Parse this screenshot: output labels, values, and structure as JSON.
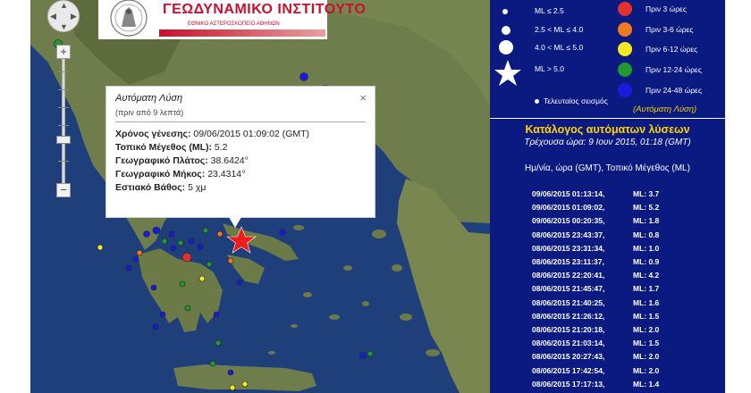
{
  "logo": {
    "title": "ΓΕΩΔΥΝΑΜΙΚΟ ΙΝΣΤΙΤΟΥΤΟ",
    "subtitle": "ΕΘΝΙΚΟ ΑΣΤΕΡΟΣΚΟΠΕΙΟ ΑΘΗΝΩΝ"
  },
  "map_controls": {
    "zoom_in": "+",
    "zoom_out": "−"
  },
  "popup": {
    "title": "Αυτόματη Λύση",
    "subtitle": "(πριν από 9 λεπτά)",
    "close": "×",
    "rows": [
      {
        "label": "Χρόνος γένεσης:",
        "value": "09/06/2015  01:09:02 (GMT)"
      },
      {
        "label": "Τοπικό Μέγεθος (ML):",
        "value": "5.2"
      },
      {
        "label": "Γεωγραφικό Πλάτος:",
        "value": "38.6424°"
      },
      {
        "label": "Γεωγραφικό Μήκος:",
        "value": "23.4314°"
      },
      {
        "label": "Εστιακό Βάθος:",
        "value": "5 χμ"
      }
    ]
  },
  "legend": {
    "magnitudes": [
      {
        "label": "ML ≤ 2.5"
      },
      {
        "label": "2.5 < ML ≤ 4.0"
      },
      {
        "label": "4.0 < ML ≤ 5.0"
      },
      {
        "label": "ML > 5.0"
      },
      {
        "label": "Τελευταίος σεισμός"
      }
    ],
    "ages": [
      {
        "label": "Πριν 3 ώρες",
        "color": "#e53030"
      },
      {
        "label": "Πριν 3-6 ώρες",
        "color": "#f07a20"
      },
      {
        "label": "Πριν 6-12 ώρες",
        "color": "#f5ea20"
      },
      {
        "label": "Πριν 12-24 ώρες",
        "color": "#1f9a2c"
      },
      {
        "label": "Πριν 24-48 ώρες",
        "color": "#1a1adc"
      }
    ],
    "auto_note": "(Αυτόματη Λύση)"
  },
  "catalog": {
    "title": "Κατάλογος αυτόματων λύσεων",
    "current_time": "Τρέχουσα ώρα: 9 Ιουν 2015, 01:18 (GMT)",
    "header": "Ημ/νία, ώρα (GMT), Τοπικό Μέγεθος (ML)",
    "rows": [
      {
        "datetime": "09/06/2015  01:13:14,",
        "ml": "ML: 3.7"
      },
      {
        "datetime": "09/06/2015  01:09:02,",
        "ml": "ML: 5.2"
      },
      {
        "datetime": "09/06/2015  00:20:35,",
        "ml": "ML: 1.8"
      },
      {
        "datetime": "08/06/2015  23:43:37,",
        "ml": "ML: 0.8"
      },
      {
        "datetime": "08/06/2015  23:31:34,",
        "ml": "ML: 1.0"
      },
      {
        "datetime": "08/06/2015  23:11:37,",
        "ml": "ML: 0.9"
      },
      {
        "datetime": "08/06/2015  22:20:41,",
        "ml": "ML: 4.2"
      },
      {
        "datetime": "08/06/2015  21:45:47,",
        "ml": "ML: 1.7"
      },
      {
        "datetime": "08/06/2015  21:40:25,",
        "ml": "ML: 1.6"
      },
      {
        "datetime": "08/06/2015  21:26:12,",
        "ml": "ML: 1.5"
      },
      {
        "datetime": "08/06/2015  21:20:18,",
        "ml": "ML: 2.0"
      },
      {
        "datetime": "08/06/2015  21:03:14,",
        "ml": "ML: 1.5"
      },
      {
        "datetime": "08/06/2015  20:27:43,",
        "ml": "ML: 2.0"
      },
      {
        "datetime": "08/06/2015  17:42:54,",
        "ml": "ML: 2.0"
      },
      {
        "datetime": "08/06/2015  17:17:13,",
        "ml": "ML: 1.4"
      }
    ]
  }
}
